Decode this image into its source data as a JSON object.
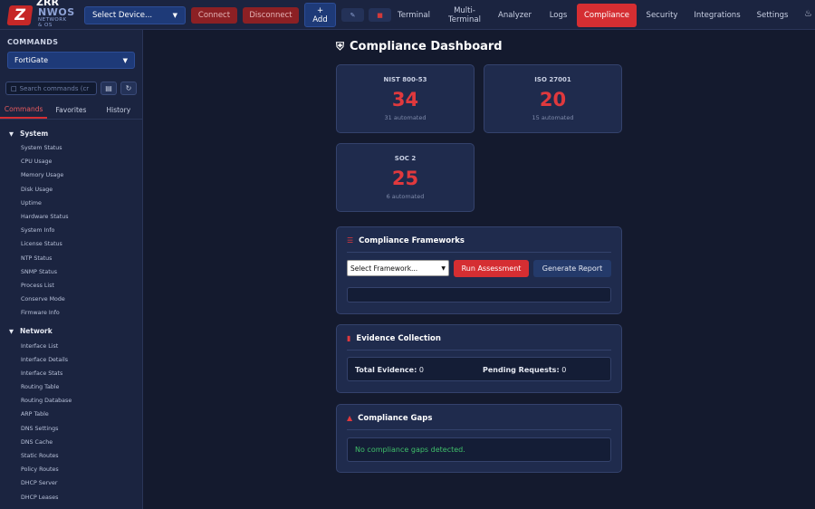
{
  "header": {
    "logo_top": "ZRR",
    "logo_name": "NWOS",
    "logo_sub1": "NETWORK",
    "logo_sub2": "& OS",
    "device_select": "Select Device...",
    "connect": "Connect",
    "disconnect": "Disconnect",
    "add_plus": "+",
    "add_label": "Add",
    "nav": [
      {
        "label": "Terminal",
        "active": false
      },
      {
        "label": "Multi-",
        "label2": "Terminal",
        "active": false
      },
      {
        "label": "Analyzer",
        "active": false
      },
      {
        "label": "Logs",
        "active": false
      },
      {
        "label": "Compliance",
        "active": true
      },
      {
        "label": "Security",
        "active": false
      },
      {
        "label": "Integrations",
        "active": false
      },
      {
        "label": "Settings",
        "active": false
      }
    ]
  },
  "sidebar": {
    "title": "COMMANDS",
    "platform": "FortiGate",
    "search_placeholder": "Search commands (cr",
    "tabs": [
      "Commands",
      "Favorites",
      "History"
    ],
    "categories": [
      {
        "name": "System",
        "items": [
          "System Status",
          "CPU Usage",
          "Memory Usage",
          "Disk Usage",
          "Uptime",
          "Hardware Status",
          "System Info",
          "License Status",
          "NTP Status",
          "SNMP Status",
          "Process List",
          "Conserve Mode",
          "Firmware Info"
        ]
      },
      {
        "name": "Network",
        "items": [
          "Interface List",
          "Interface Details",
          "Interface Stats",
          "Routing Table",
          "Routing Database",
          "ARP Table",
          "DNS Settings",
          "DNS Cache",
          "Static Routes",
          "Policy Routes",
          "DHCP Server",
          "DHCP Leases"
        ]
      }
    ]
  },
  "main": {
    "title": "Compliance Dashboard",
    "cards": [
      {
        "name": "NIST 800-53",
        "value": "34",
        "automated": "31 automated"
      },
      {
        "name": "ISO 27001",
        "value": "20",
        "automated": "15 automated"
      },
      {
        "name": "SOC 2",
        "value": "25",
        "automated": "6 automated"
      }
    ],
    "frameworks": {
      "title": "Compliance Frameworks",
      "select": "Select Framework...",
      "run": "Run Assessment",
      "generate": "Generate Report"
    },
    "evidence": {
      "title": "Evidence Collection",
      "total_label": "Total Evidence:",
      "total_value": "0",
      "pending_label": "Pending Requests:",
      "pending_value": "0"
    },
    "gaps": {
      "title": "Compliance Gaps",
      "message": "No compliance gaps detected."
    }
  },
  "colors": {
    "accent": "#d52e32",
    "panel": "#1f2b4d",
    "background": "#141a2e",
    "success": "#3fbf6a"
  }
}
